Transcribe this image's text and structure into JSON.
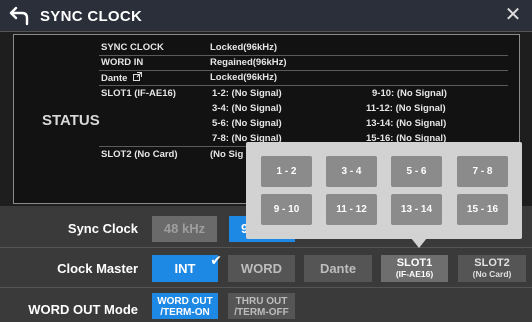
{
  "window": {
    "title": "SYNC CLOCK"
  },
  "status": {
    "label": "STATUS",
    "sync_clock": {
      "name": "SYNC CLOCK",
      "value": "Locked(96kHz)"
    },
    "word_in": {
      "name": "WORD IN",
      "value": "Regained(96kHz)"
    },
    "dante": {
      "name": "Dante",
      "value": "Locked(96kHz)"
    },
    "slot1": {
      "name": "SLOT1 (IF-AE16)",
      "left": [
        "1-2:  (No Signal)",
        "3-4:  (No Signal)",
        "5-6:  (No Signal)",
        "7-8:  (No Signal)"
      ],
      "right": [
        "9-10:  (No Signal)",
        "11-12:  (No Signal)",
        "13-14:  (No Signal)",
        "15-16:  (No Signal)"
      ]
    },
    "slot2": {
      "name": "SLOT2 (No Card)",
      "value": "(No Sig"
    }
  },
  "sync_clock": {
    "label": "Sync Clock",
    "options": [
      "48 kHz",
      "9"
    ]
  },
  "clock_master": {
    "label": "Clock Master",
    "options": [
      "INT",
      "WORD",
      "Dante"
    ],
    "slot1": {
      "main": "SLOT1",
      "sub": "(IF-AE16)"
    },
    "slot2": {
      "main": "SLOT2",
      "sub": "(No Card)"
    }
  },
  "word_out": {
    "label": "WORD OUT Mode",
    "opt1": {
      "line1": "WORD OUT",
      "line2": "/TERM-ON"
    },
    "opt2": {
      "line1": "THRU OUT",
      "line2": "/TERM-OFF"
    }
  },
  "popup": {
    "row1": [
      "1 - 2",
      "3 - 4",
      "5 - 6",
      "7 - 8"
    ],
    "row2": [
      "9 - 10",
      "11 - 12",
      "13 - 14",
      "15 - 16"
    ]
  },
  "colors": {
    "accent": "#1e88e5",
    "panel": "#3a3a3a",
    "popup": "#d2d2d2"
  }
}
